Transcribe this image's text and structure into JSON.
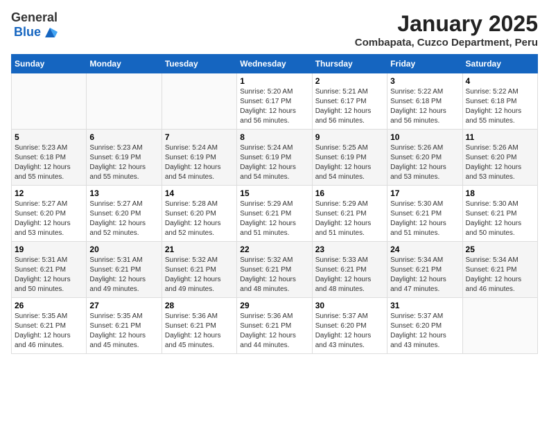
{
  "logo": {
    "general": "General",
    "blue": "Blue"
  },
  "title": "January 2025",
  "subtitle": "Combapata, Cuzco Department, Peru",
  "days_of_week": [
    "Sunday",
    "Monday",
    "Tuesday",
    "Wednesday",
    "Thursday",
    "Friday",
    "Saturday"
  ],
  "weeks": [
    [
      {
        "day": "",
        "info": ""
      },
      {
        "day": "",
        "info": ""
      },
      {
        "day": "",
        "info": ""
      },
      {
        "day": "1",
        "info": "Sunrise: 5:20 AM\nSunset: 6:17 PM\nDaylight: 12 hours and 56 minutes."
      },
      {
        "day": "2",
        "info": "Sunrise: 5:21 AM\nSunset: 6:17 PM\nDaylight: 12 hours and 56 minutes."
      },
      {
        "day": "3",
        "info": "Sunrise: 5:22 AM\nSunset: 6:18 PM\nDaylight: 12 hours and 56 minutes."
      },
      {
        "day": "4",
        "info": "Sunrise: 5:22 AM\nSunset: 6:18 PM\nDaylight: 12 hours and 55 minutes."
      }
    ],
    [
      {
        "day": "5",
        "info": "Sunrise: 5:23 AM\nSunset: 6:18 PM\nDaylight: 12 hours and 55 minutes."
      },
      {
        "day": "6",
        "info": "Sunrise: 5:23 AM\nSunset: 6:19 PM\nDaylight: 12 hours and 55 minutes."
      },
      {
        "day": "7",
        "info": "Sunrise: 5:24 AM\nSunset: 6:19 PM\nDaylight: 12 hours and 54 minutes."
      },
      {
        "day": "8",
        "info": "Sunrise: 5:24 AM\nSunset: 6:19 PM\nDaylight: 12 hours and 54 minutes."
      },
      {
        "day": "9",
        "info": "Sunrise: 5:25 AM\nSunset: 6:19 PM\nDaylight: 12 hours and 54 minutes."
      },
      {
        "day": "10",
        "info": "Sunrise: 5:26 AM\nSunset: 6:20 PM\nDaylight: 12 hours and 53 minutes."
      },
      {
        "day": "11",
        "info": "Sunrise: 5:26 AM\nSunset: 6:20 PM\nDaylight: 12 hours and 53 minutes."
      }
    ],
    [
      {
        "day": "12",
        "info": "Sunrise: 5:27 AM\nSunset: 6:20 PM\nDaylight: 12 hours and 53 minutes."
      },
      {
        "day": "13",
        "info": "Sunrise: 5:27 AM\nSunset: 6:20 PM\nDaylight: 12 hours and 52 minutes."
      },
      {
        "day": "14",
        "info": "Sunrise: 5:28 AM\nSunset: 6:20 PM\nDaylight: 12 hours and 52 minutes."
      },
      {
        "day": "15",
        "info": "Sunrise: 5:29 AM\nSunset: 6:21 PM\nDaylight: 12 hours and 51 minutes."
      },
      {
        "day": "16",
        "info": "Sunrise: 5:29 AM\nSunset: 6:21 PM\nDaylight: 12 hours and 51 minutes."
      },
      {
        "day": "17",
        "info": "Sunrise: 5:30 AM\nSunset: 6:21 PM\nDaylight: 12 hours and 51 minutes."
      },
      {
        "day": "18",
        "info": "Sunrise: 5:30 AM\nSunset: 6:21 PM\nDaylight: 12 hours and 50 minutes."
      }
    ],
    [
      {
        "day": "19",
        "info": "Sunrise: 5:31 AM\nSunset: 6:21 PM\nDaylight: 12 hours and 50 minutes."
      },
      {
        "day": "20",
        "info": "Sunrise: 5:31 AM\nSunset: 6:21 PM\nDaylight: 12 hours and 49 minutes."
      },
      {
        "day": "21",
        "info": "Sunrise: 5:32 AM\nSunset: 6:21 PM\nDaylight: 12 hours and 49 minutes."
      },
      {
        "day": "22",
        "info": "Sunrise: 5:32 AM\nSunset: 6:21 PM\nDaylight: 12 hours and 48 minutes."
      },
      {
        "day": "23",
        "info": "Sunrise: 5:33 AM\nSunset: 6:21 PM\nDaylight: 12 hours and 48 minutes."
      },
      {
        "day": "24",
        "info": "Sunrise: 5:34 AM\nSunset: 6:21 PM\nDaylight: 12 hours and 47 minutes."
      },
      {
        "day": "25",
        "info": "Sunrise: 5:34 AM\nSunset: 6:21 PM\nDaylight: 12 hours and 46 minutes."
      }
    ],
    [
      {
        "day": "26",
        "info": "Sunrise: 5:35 AM\nSunset: 6:21 PM\nDaylight: 12 hours and 46 minutes."
      },
      {
        "day": "27",
        "info": "Sunrise: 5:35 AM\nSunset: 6:21 PM\nDaylight: 12 hours and 45 minutes."
      },
      {
        "day": "28",
        "info": "Sunrise: 5:36 AM\nSunset: 6:21 PM\nDaylight: 12 hours and 45 minutes."
      },
      {
        "day": "29",
        "info": "Sunrise: 5:36 AM\nSunset: 6:21 PM\nDaylight: 12 hours and 44 minutes."
      },
      {
        "day": "30",
        "info": "Sunrise: 5:37 AM\nSunset: 6:20 PM\nDaylight: 12 hours and 43 minutes."
      },
      {
        "day": "31",
        "info": "Sunrise: 5:37 AM\nSunset: 6:20 PM\nDaylight: 12 hours and 43 minutes."
      },
      {
        "day": "",
        "info": ""
      }
    ]
  ]
}
